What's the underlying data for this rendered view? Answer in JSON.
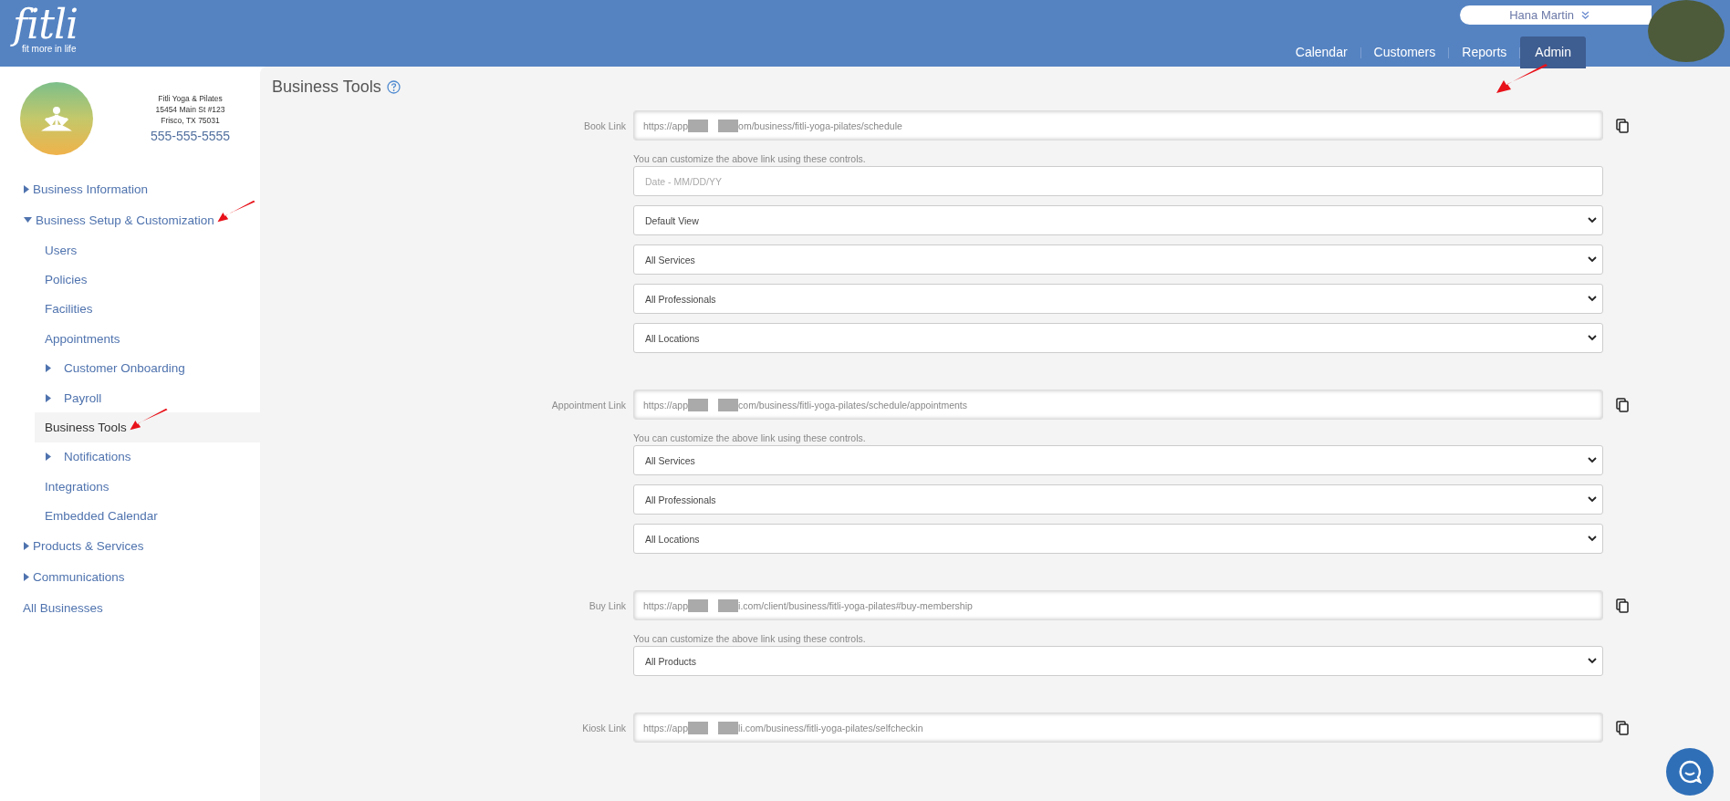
{
  "header": {
    "logo_text": "fitli",
    "tagline": "fit more in life",
    "user_name": "Hana Martin",
    "tabs": [
      {
        "label": "Calendar",
        "selected": false,
        "pointer_arrow": false
      },
      {
        "label": "Customers",
        "selected": false,
        "pointer_arrow": false
      },
      {
        "label": "Reports",
        "selected": false,
        "pointer_arrow": false
      },
      {
        "label": "Admin",
        "selected": true,
        "pointer_arrow": true
      }
    ]
  },
  "business": {
    "name": "Fitli Yoga & Pilates",
    "address_line_1": "15454 Main St #123",
    "address_line_2": "Frisco, TX 75031",
    "phone": "555-555-5555"
  },
  "sidebar": {
    "items": [
      {
        "label": "Business Information",
        "expanded": false,
        "selected": false,
        "pointer_arrow": false
      },
      {
        "label": "Business Setup & Customization",
        "expanded": true,
        "selected": false,
        "pointer_arrow": true,
        "children": [
          {
            "label": "Users",
            "selected": false,
            "pointer_arrow": false
          },
          {
            "label": "Policies",
            "selected": false,
            "pointer_arrow": false
          },
          {
            "label": "Facilities",
            "selected": false,
            "pointer_arrow": false
          },
          {
            "label": "Appointments",
            "selected": false,
            "pointer_arrow": false
          },
          {
            "label": "Customer Onboarding",
            "expanded": false,
            "selected": false,
            "pointer_arrow": false
          },
          {
            "label": "Payroll",
            "expanded": false,
            "selected": false,
            "pointer_arrow": false
          },
          {
            "label": "Business Tools",
            "selected": true,
            "pointer_arrow": true
          },
          {
            "label": "Notifications",
            "expanded": false,
            "selected": false,
            "pointer_arrow": false
          },
          {
            "label": "Integrations",
            "selected": false,
            "pointer_arrow": false
          },
          {
            "label": "Embedded Calendar",
            "selected": false,
            "pointer_arrow": false
          }
        ]
      },
      {
        "label": "Products & Services",
        "expanded": false,
        "selected": false,
        "pointer_arrow": false
      },
      {
        "label": "Communications",
        "expanded": false,
        "selected": false,
        "pointer_arrow": false
      },
      {
        "label": "All Businesses",
        "selected": false,
        "pointer_arrow": false
      }
    ]
  },
  "page_title": "Business Tools",
  "links": [
    {
      "label": "Book Link",
      "url_parts": [
        "https://app",
        "om/business/fitli-yoga-pilates/schedule"
      ],
      "hint": "You can customize the above link using these controls.",
      "controls": [
        {
          "kind": "date",
          "placeholder": "Date - MM/DD/YY"
        },
        {
          "kind": "select",
          "value": "Default View"
        },
        {
          "kind": "select",
          "value": "All Services"
        },
        {
          "kind": "select",
          "value": "All Professionals"
        },
        {
          "kind": "select",
          "value": "All Locations"
        }
      ]
    },
    {
      "label": "Appointment Link",
      "url_parts": [
        "https://app",
        "com/business/fitli-yoga-pilates/schedule/appointments"
      ],
      "hint": "You can customize the above link using these controls.",
      "controls": [
        {
          "kind": "select",
          "value": "All Services"
        },
        {
          "kind": "select",
          "value": "All Professionals"
        },
        {
          "kind": "select",
          "value": "All Locations"
        }
      ]
    },
    {
      "label": "Buy Link",
      "url_parts": [
        "https://app",
        "i.com/client/business/fitli-yoga-pilates#buy-membership"
      ],
      "hint": "You can customize the above link using these controls.",
      "controls": [
        {
          "kind": "select",
          "value": "All Products"
        }
      ]
    },
    {
      "label": "Kiosk Link",
      "url_parts": [
        "https://app",
        "li.com/business/fitli-yoga-pilates/selfcheckin"
      ]
    }
  ]
}
